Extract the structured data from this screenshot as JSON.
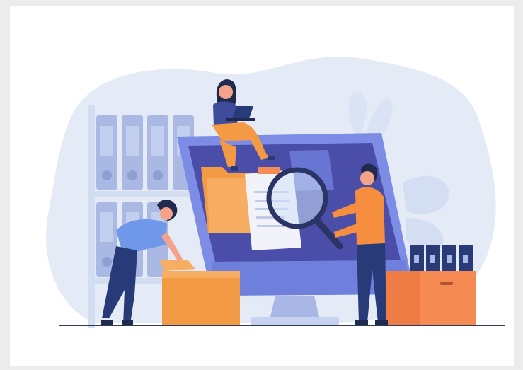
{
  "illustration": {
    "colors": {
      "frame_background": "#ececec",
      "canvas_background": "#ffffff",
      "blob": "#e4ebf6",
      "shelf": "#d3ddf0",
      "binder": "#aab9e3",
      "monitor_frame": "#7d8de6",
      "monitor_screen": "#4b4ea8",
      "folder": "#f39a45",
      "skin": "#f4a38a",
      "hair": "#1f2a4d",
      "shirt_blue": "#5a7ce0",
      "shirt_orange": "#f58f3f",
      "pants": "#283a78",
      "paper": "#f1f3f8",
      "box": "#f58b52",
      "ground": "#2e3a5b"
    },
    "icons": [
      "bookshelf-icon",
      "binder-icon",
      "computer-monitor-icon",
      "folder-icon",
      "document-icon",
      "magnifying-glass-icon",
      "laptop-icon",
      "person-icon",
      "plant-leaf-icon",
      "storage-box-icon"
    ]
  }
}
